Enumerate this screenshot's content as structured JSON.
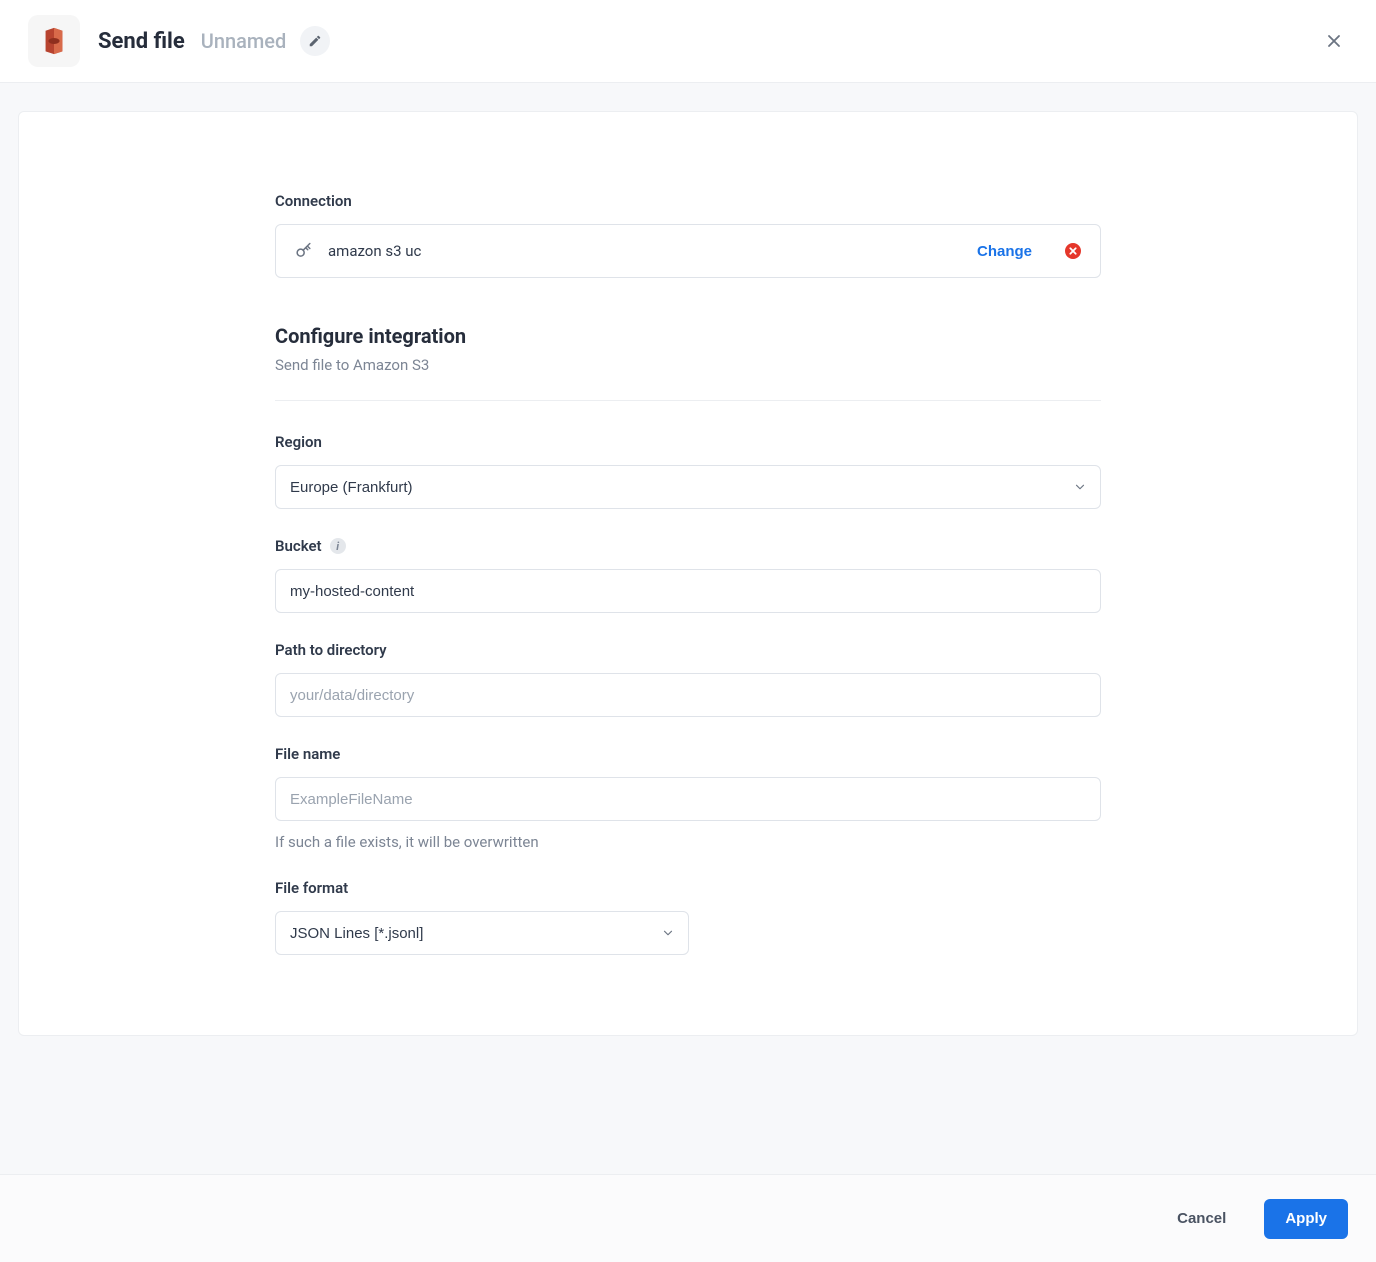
{
  "header": {
    "title": "Send file",
    "subtitle": "Unnamed"
  },
  "connection": {
    "label": "Connection",
    "name": "amazon s3 uc",
    "change_label": "Change"
  },
  "configure": {
    "heading": "Configure integration",
    "subheading": "Send file to Amazon S3"
  },
  "form": {
    "region": {
      "label": "Region",
      "value": "Europe (Frankfurt)"
    },
    "bucket": {
      "label": "Bucket",
      "value": "my-hosted-content"
    },
    "path": {
      "label": "Path to directory",
      "placeholder": "your/data/directory",
      "value": ""
    },
    "filename": {
      "label": "File name",
      "placeholder": "ExampleFileName",
      "value": "",
      "help": "If such a file exists, it will be overwritten"
    },
    "fileformat": {
      "label": "File format",
      "value": "JSON Lines [*.jsonl]"
    }
  },
  "footer": {
    "cancel": "Cancel",
    "apply": "Apply"
  }
}
